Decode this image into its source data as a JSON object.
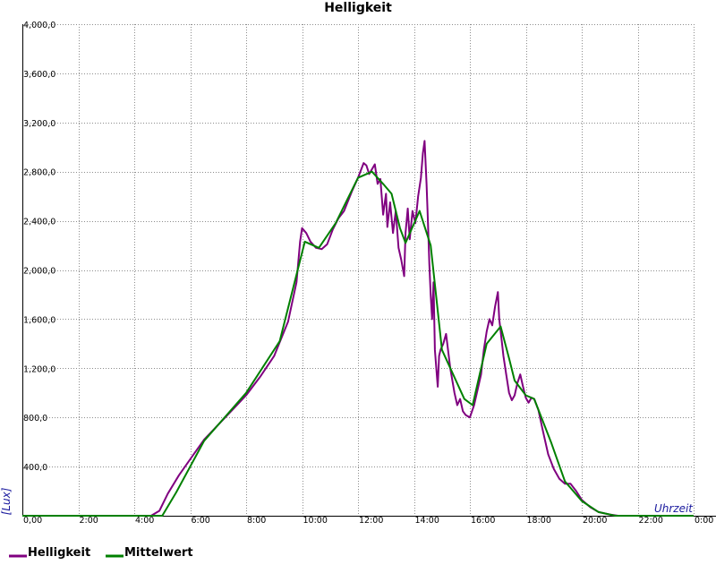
{
  "chart_data": {
    "type": "line",
    "title": "Helligkeit",
    "xlabel": "Uhrzeit",
    "ylabel": "[Lux]",
    "xlim": [
      0,
      24
    ],
    "ylim": [
      0,
      4000
    ],
    "x_ticks": [
      {
        "v": 0,
        "label": "0,00"
      },
      {
        "v": 2,
        "label": "2:00"
      },
      {
        "v": 4,
        "label": "4:00"
      },
      {
        "v": 6,
        "label": "6:00"
      },
      {
        "v": 8,
        "label": "8:00"
      },
      {
        "v": 10,
        "label": "10:00"
      },
      {
        "v": 12,
        "label": "12:00"
      },
      {
        "v": 14,
        "label": "14:00"
      },
      {
        "v": 16,
        "label": "16:00"
      },
      {
        "v": 18,
        "label": "18:00"
      },
      {
        "v": 20,
        "label": "20:00"
      },
      {
        "v": 22,
        "label": "22:00"
      },
      {
        "v": 24,
        "label": "0:00"
      }
    ],
    "y_ticks": [
      {
        "v": 400,
        "label": "400,0"
      },
      {
        "v": 800,
        "label": "800,0"
      },
      {
        "v": 1200,
        "label": "1,200,0"
      },
      {
        "v": 1600,
        "label": "1,600,0"
      },
      {
        "v": 2000,
        "label": "2,000,0"
      },
      {
        "v": 2400,
        "label": "2,400,0"
      },
      {
        "v": 2800,
        "label": "2,800,0"
      },
      {
        "v": 3200,
        "label": "3,200,0"
      },
      {
        "v": 3600,
        "label": "3,600,0"
      },
      {
        "v": 4000,
        "label": "4,000,0"
      }
    ],
    "grid": true,
    "legend_position": "bottom-left",
    "series": [
      {
        "name": "Helligkeit",
        "color": "#800080",
        "points": [
          [
            0,
            0
          ],
          [
            4.6,
            0
          ],
          [
            4.9,
            40
          ],
          [
            5.2,
            180
          ],
          [
            5.6,
            330
          ],
          [
            6.0,
            460
          ],
          [
            6.5,
            620
          ],
          [
            7.0,
            740
          ],
          [
            7.5,
            860
          ],
          [
            8.0,
            980
          ],
          [
            8.5,
            1130
          ],
          [
            9.0,
            1300
          ],
          [
            9.5,
            1580
          ],
          [
            9.8,
            1900
          ],
          [
            9.93,
            2230
          ],
          [
            10.0,
            2340
          ],
          [
            10.15,
            2300
          ],
          [
            10.3,
            2230
          ],
          [
            10.5,
            2180
          ],
          [
            10.7,
            2170
          ],
          [
            10.9,
            2210
          ],
          [
            11.1,
            2330
          ],
          [
            11.3,
            2420
          ],
          [
            11.5,
            2480
          ],
          [
            11.8,
            2650
          ],
          [
            12.0,
            2750
          ],
          [
            12.2,
            2870
          ],
          [
            12.3,
            2850
          ],
          [
            12.4,
            2780
          ],
          [
            12.5,
            2820
          ],
          [
            12.6,
            2860
          ],
          [
            12.7,
            2700
          ],
          [
            12.8,
            2740
          ],
          [
            12.9,
            2450
          ],
          [
            13.0,
            2620
          ],
          [
            13.05,
            2350
          ],
          [
            13.15,
            2550
          ],
          [
            13.25,
            2300
          ],
          [
            13.35,
            2480
          ],
          [
            13.45,
            2180
          ],
          [
            13.55,
            2080
          ],
          [
            13.65,
            1950
          ],
          [
            13.7,
            2300
          ],
          [
            13.78,
            2500
          ],
          [
            13.85,
            2250
          ],
          [
            13.95,
            2480
          ],
          [
            14.05,
            2380
          ],
          [
            14.15,
            2600
          ],
          [
            14.25,
            2750
          ],
          [
            14.32,
            2950
          ],
          [
            14.38,
            3050
          ],
          [
            14.45,
            2700
          ],
          [
            14.5,
            2400
          ],
          [
            14.55,
            2050
          ],
          [
            14.6,
            1800
          ],
          [
            14.65,
            1600
          ],
          [
            14.7,
            1900
          ],
          [
            14.75,
            1350
          ],
          [
            14.8,
            1200
          ],
          [
            14.85,
            1050
          ],
          [
            14.9,
            1300
          ],
          [
            14.95,
            1350
          ],
          [
            15.05,
            1400
          ],
          [
            15.15,
            1480
          ],
          [
            15.3,
            1200
          ],
          [
            15.45,
            1000
          ],
          [
            15.55,
            900
          ],
          [
            15.65,
            950
          ],
          [
            15.75,
            850
          ],
          [
            15.85,
            820
          ],
          [
            16.0,
            800
          ],
          [
            16.15,
            900
          ],
          [
            16.3,
            1050
          ],
          [
            16.4,
            1150
          ],
          [
            16.5,
            1350
          ],
          [
            16.6,
            1500
          ],
          [
            16.7,
            1600
          ],
          [
            16.8,
            1550
          ],
          [
            16.9,
            1700
          ],
          [
            17.0,
            1820
          ],
          [
            17.05,
            1600
          ],
          [
            17.1,
            1500
          ],
          [
            17.2,
            1300
          ],
          [
            17.3,
            1150
          ],
          [
            17.4,
            1000
          ],
          [
            17.5,
            940
          ],
          [
            17.6,
            980
          ],
          [
            17.7,
            1080
          ],
          [
            17.8,
            1150
          ],
          [
            17.9,
            1050
          ],
          [
            18.0,
            960
          ],
          [
            18.1,
            920
          ],
          [
            18.2,
            960
          ],
          [
            18.3,
            950
          ],
          [
            18.45,
            860
          ],
          [
            18.6,
            700
          ],
          [
            18.8,
            500
          ],
          [
            19.0,
            380
          ],
          [
            19.2,
            300
          ],
          [
            19.4,
            260
          ],
          [
            19.6,
            260
          ],
          [
            19.8,
            200
          ],
          [
            20.0,
            130
          ],
          [
            20.3,
            70
          ],
          [
            20.6,
            30
          ],
          [
            21.0,
            10
          ],
          [
            21.3,
            0
          ],
          [
            24,
            0
          ]
        ]
      },
      {
        "name": "Mittelwert",
        "color": "#008000",
        "points": [
          [
            0,
            0
          ],
          [
            5.0,
            0
          ],
          [
            5.5,
            190
          ],
          [
            6.5,
            610
          ],
          [
            8.0,
            1000
          ],
          [
            9.2,
            1420
          ],
          [
            10.1,
            2230
          ],
          [
            10.6,
            2180
          ],
          [
            11.2,
            2380
          ],
          [
            12.0,
            2750
          ],
          [
            12.5,
            2800
          ],
          [
            12.9,
            2700
          ],
          [
            13.2,
            2620
          ],
          [
            13.5,
            2340
          ],
          [
            13.7,
            2220
          ],
          [
            14.2,
            2480
          ],
          [
            14.6,
            2200
          ],
          [
            15.0,
            1350
          ],
          [
            15.8,
            950
          ],
          [
            16.1,
            900
          ],
          [
            16.6,
            1400
          ],
          [
            17.1,
            1540
          ],
          [
            17.4,
            1280
          ],
          [
            17.6,
            1100
          ],
          [
            18.0,
            980
          ],
          [
            18.3,
            950
          ],
          [
            18.9,
            600
          ],
          [
            19.4,
            280
          ],
          [
            20.0,
            120
          ],
          [
            20.6,
            30
          ],
          [
            21.2,
            0
          ],
          [
            24,
            0
          ]
        ]
      }
    ]
  }
}
